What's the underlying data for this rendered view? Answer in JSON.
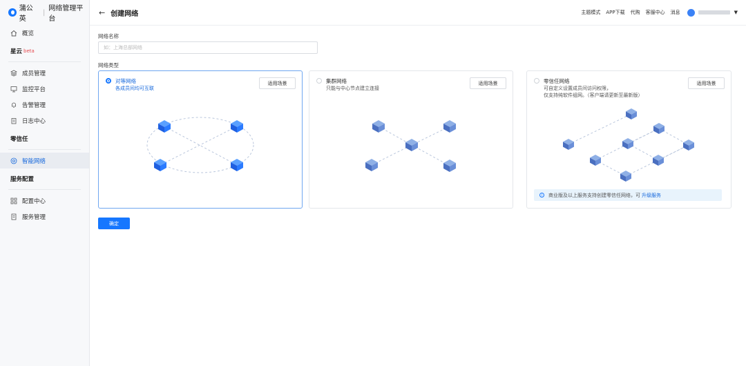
{
  "brand": {
    "name": "蒲公英",
    "product": "网络管理平台"
  },
  "sidebar": {
    "overview": "概览",
    "group_xingyun": "星云",
    "group_xingyun_tag": "beta",
    "xingyun_items": [
      "成员管理",
      "监控平台",
      "告警管理",
      "日志中心"
    ],
    "group_zero": "零信任",
    "zero_items": [
      "智能网络"
    ],
    "group_service": "服务配置",
    "service_items": [
      "配置中心",
      "服务管理"
    ]
  },
  "header": {
    "back_icon": "←",
    "title": "创建网络",
    "links": [
      "主题模式",
      "APP下载",
      "代购",
      "客服中心",
      "消息"
    ]
  },
  "form": {
    "name_label": "网络名称",
    "name_placeholder": "如：上海总部网络",
    "type_label": "网络类型",
    "confirm_label": "确定"
  },
  "cards": [
    {
      "title": "对等网络",
      "desc": [
        "各成员间均可互联"
      ],
      "button": "适用场景",
      "selected": true
    },
    {
      "title": "集群网络",
      "desc": [
        "只能与中心节点建立连接"
      ],
      "button": "适用场景",
      "selected": false
    },
    {
      "title": "零信任网络",
      "desc": [
        "可自定义设置成员间访问权限，",
        "仅支持纯软件组网。（客户端请更新至最新版）"
      ],
      "button": "适用场景",
      "selected": false,
      "notice": "商业版及以上服务支持创建零信任网络，可",
      "notice_link": "升级服务"
    }
  ],
  "colors": {
    "accent": "#1677ff",
    "cube": "#4a78c9"
  }
}
